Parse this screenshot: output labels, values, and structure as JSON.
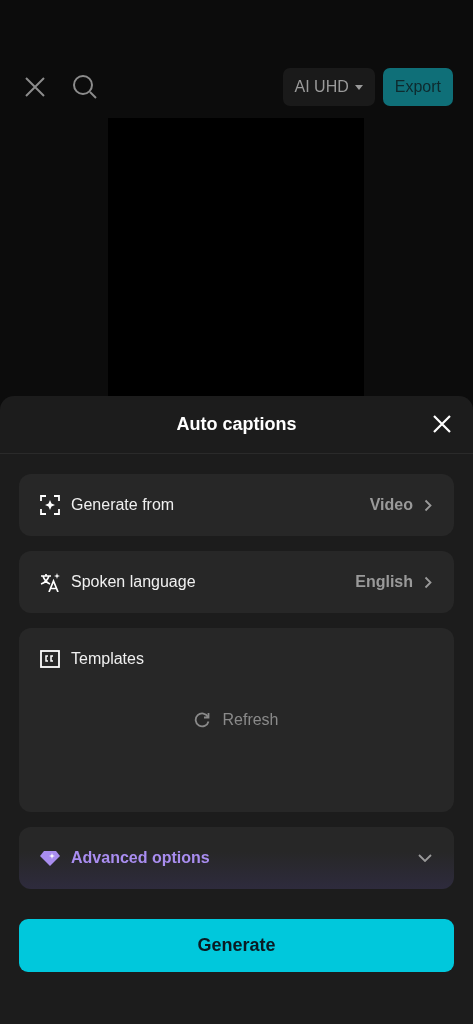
{
  "top_bar": {
    "quality": "AI UHD",
    "export": "Export"
  },
  "sheet": {
    "title": "Auto captions",
    "rows": [
      {
        "kind": "select",
        "label": "Generate from",
        "value": "Video"
      },
      {
        "kind": "select",
        "label": "Spoken language",
        "value": "English"
      }
    ],
    "templates": {
      "label": "Templates",
      "refresh": "Refresh"
    },
    "advanced": {
      "label": "Advanced options",
      "expanded": false
    },
    "generate": "Generate"
  }
}
